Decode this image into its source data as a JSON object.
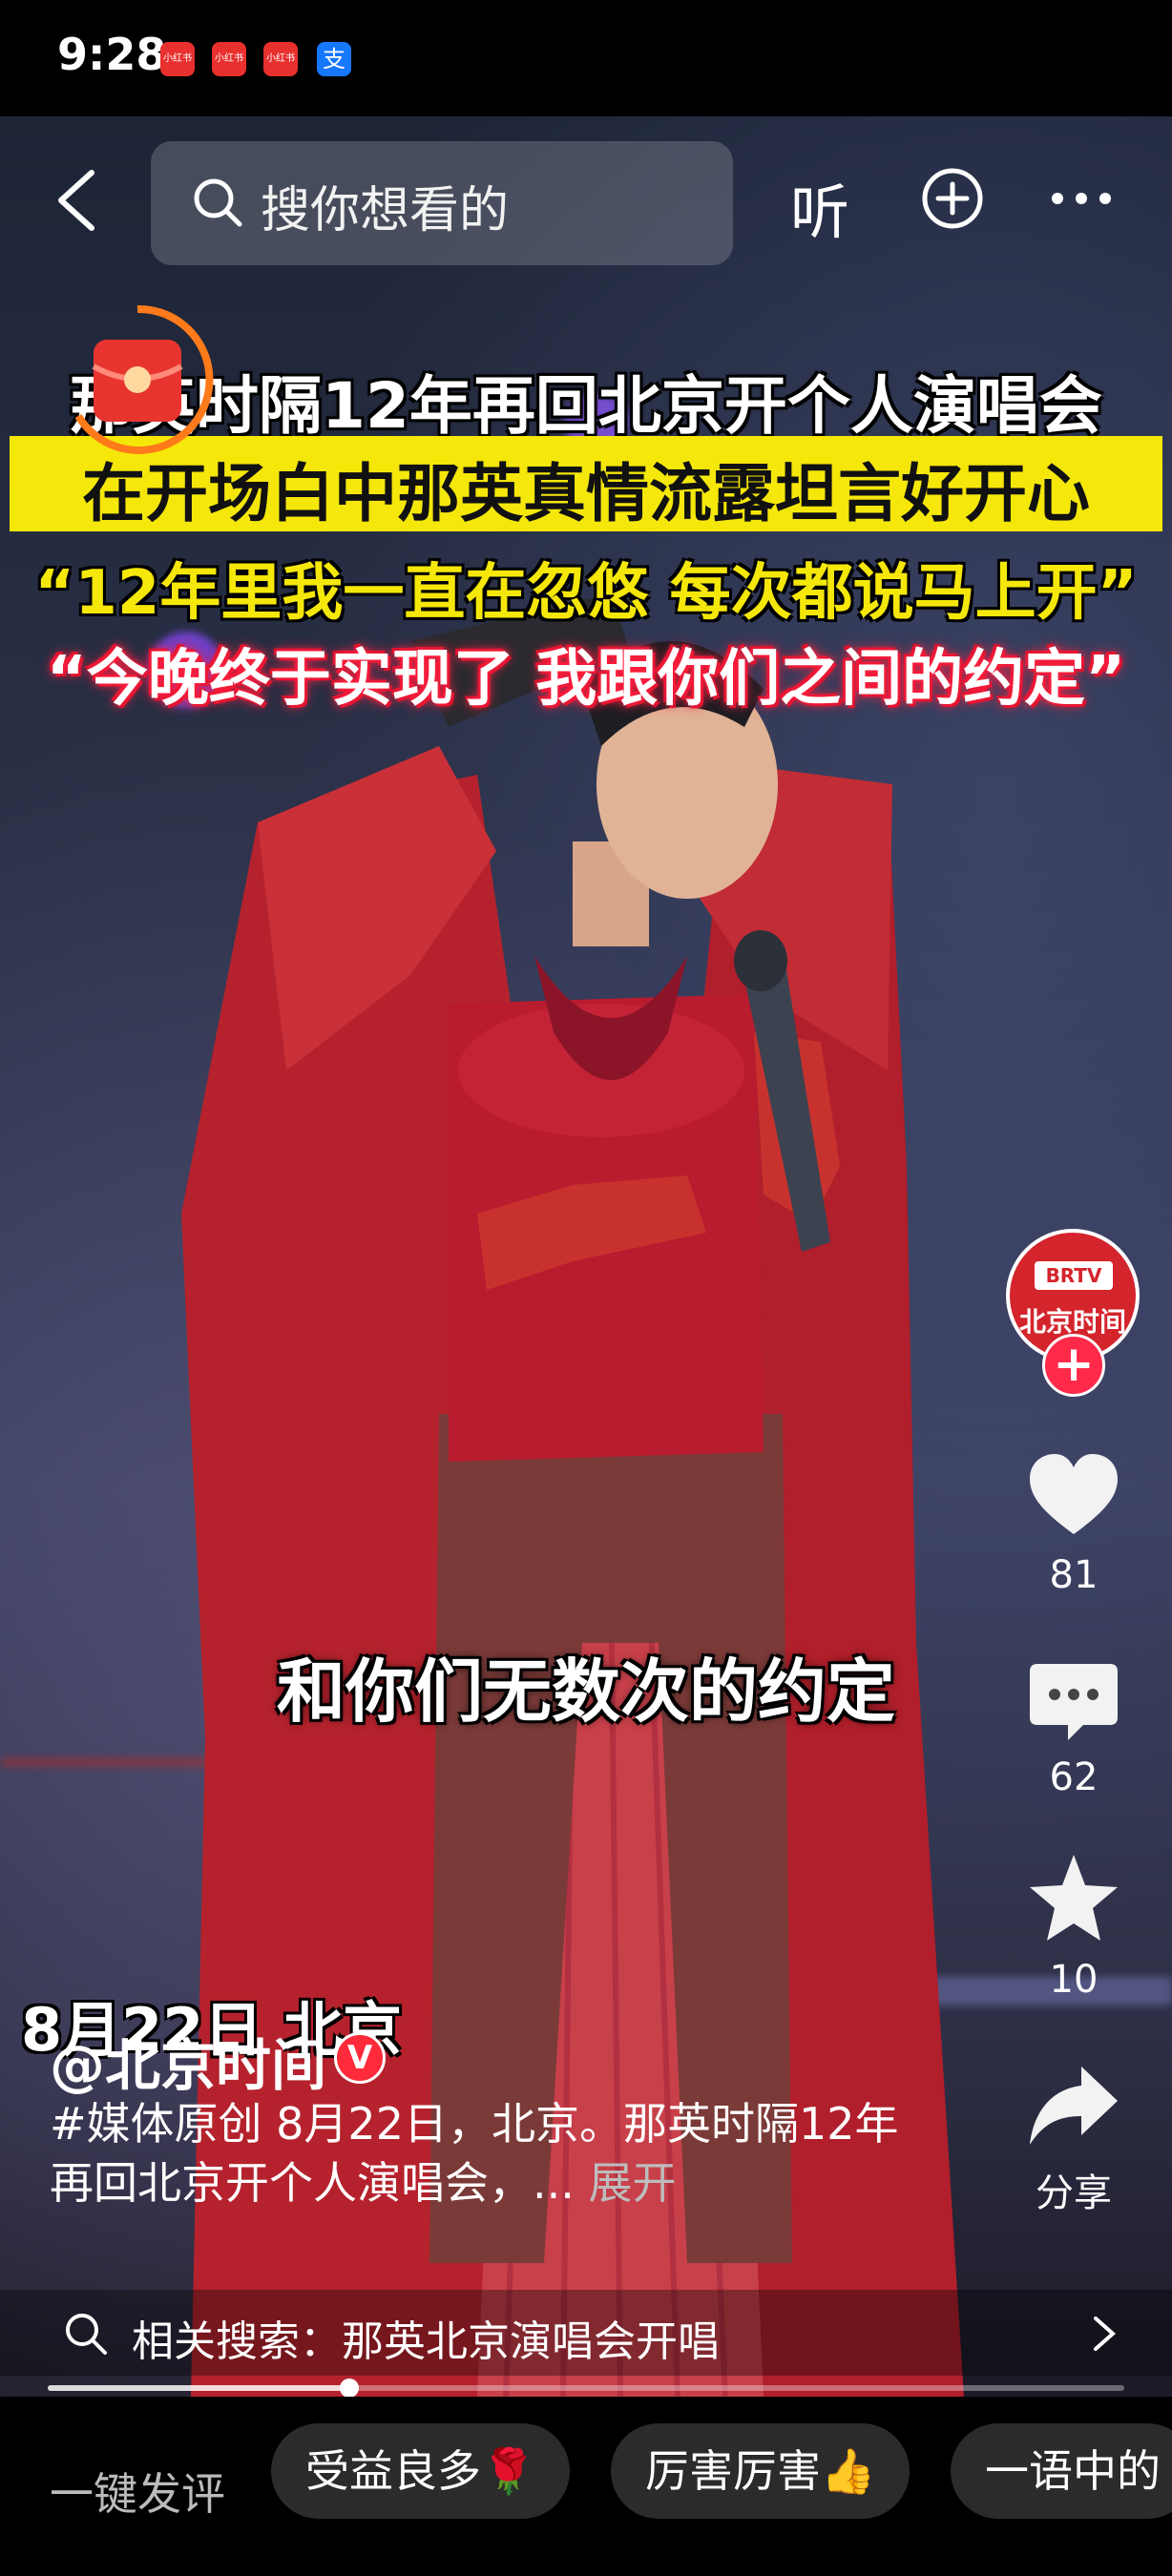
{
  "status_bar": {
    "time": "9:28",
    "apps": [
      "小红书",
      "小红书",
      "小红书",
      "支"
    ]
  },
  "top_nav": {
    "search_placeholder": "搜你想看的",
    "listen_label": "听"
  },
  "captions": {
    "line1": "那英时隔12年再回北京开个人演唱会",
    "line2": "在开场白中那英真情流露坦言好开心",
    "line3": "“12年里我一直在忽悠 每次都说马上开”",
    "line4": "“今晚终于实现了 我跟你们之间的约定”"
  },
  "video_subtitle": "和你们无数次的约定",
  "date_location": "8月22日 北京",
  "right_rail": {
    "avatar_logo": "BRTV",
    "avatar_name": "北京时间",
    "likes": "81",
    "comments": "62",
    "favorites": "10",
    "share_label": "分享"
  },
  "post": {
    "author": "@北京时间",
    "verified_mark": "V",
    "description": "#媒体原创  8月22日，北京。那英时隔12年再回北京开个人演唱会，...",
    "expand_label": "展开"
  },
  "related_search": {
    "text": "相关搜索：那英北京演唱会开唱"
  },
  "progress": {
    "fraction": 0.28
  },
  "comment_bar": {
    "label": "一键发评",
    "chips": [
      "受益良多🌹",
      "厉害厉害👍",
      "一语中的"
    ]
  }
}
